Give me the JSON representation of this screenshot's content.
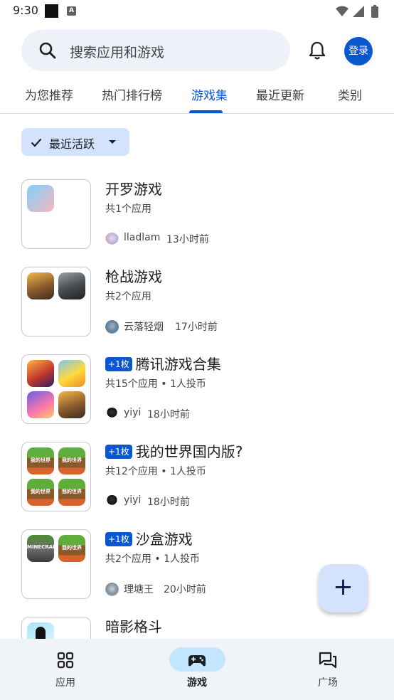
{
  "status_bar": {
    "time": "9:30",
    "a_icon": "A"
  },
  "search": {
    "placeholder": "搜索应用和游戏"
  },
  "header": {
    "login_label": "登录"
  },
  "tabs": [
    {
      "label": "为您推荐"
    },
    {
      "label": "热门排行榜"
    },
    {
      "label": "游戏集",
      "active": true
    },
    {
      "label": "最近更新"
    },
    {
      "label": "类别"
    }
  ],
  "filter": {
    "label": "最近活跃"
  },
  "collections": [
    {
      "title": "开罗游戏",
      "badge": "",
      "subtitle": "共1个应用",
      "author": "lladlam",
      "time": "13小时前",
      "icons": [
        "kairo-icon"
      ]
    },
    {
      "title": "枪战游戏",
      "badge": "",
      "subtitle": "共2个应用",
      "author": "云落轻烟",
      "time": "17小时前",
      "icons": [
        "pubg-icon",
        "cod-icon"
      ]
    },
    {
      "title": "腾讯游戏合集",
      "badge": "+1枚",
      "subtitle": "共15个应用 • 1人投币",
      "author": "yiyi",
      "time": "18小时前",
      "icons": [
        "honor-of-kings-icon",
        "pikachu-icon",
        "anime-game-icon",
        "pubg-icon"
      ]
    },
    {
      "title": "我的世界国内版?",
      "badge": "+1枚",
      "subtitle": "共12个应用 • 1人投币",
      "author": "yiyi",
      "time": "18小时前",
      "icons": [
        "minecraft-icon",
        "minecraft-icon",
        "minecraft-icon",
        "minecraft-icon"
      ]
    },
    {
      "title": "沙盒游戏",
      "badge": "+1枚",
      "subtitle": "共2个应用 • 1人投币",
      "author": "理塘王",
      "time": "20小时前",
      "icons": [
        "minecraft-java-icon",
        "minecraft-icon"
      ]
    },
    {
      "title": "暗影格斗",
      "badge": "",
      "subtitle": "",
      "author": "",
      "time": "",
      "icons": [
        "shadow-fight-icon"
      ]
    }
  ],
  "mc_icon_text": "我的世界",
  "mcj_icon_text": "MINECRAFT",
  "fab": {
    "symbol": "+"
  },
  "bottom_nav": [
    {
      "label": "应用",
      "icon": "apps-grid-icon"
    },
    {
      "label": "游戏",
      "icon": "gamepad-icon",
      "active": true
    },
    {
      "label": "广场",
      "icon": "forum-icon"
    }
  ],
  "colors": {
    "accent": "#0b57d0",
    "chip_bg": "#d3e3fd",
    "nav_bg": "#f0f3f8",
    "nav_active_pill": "#c2e7ff"
  }
}
